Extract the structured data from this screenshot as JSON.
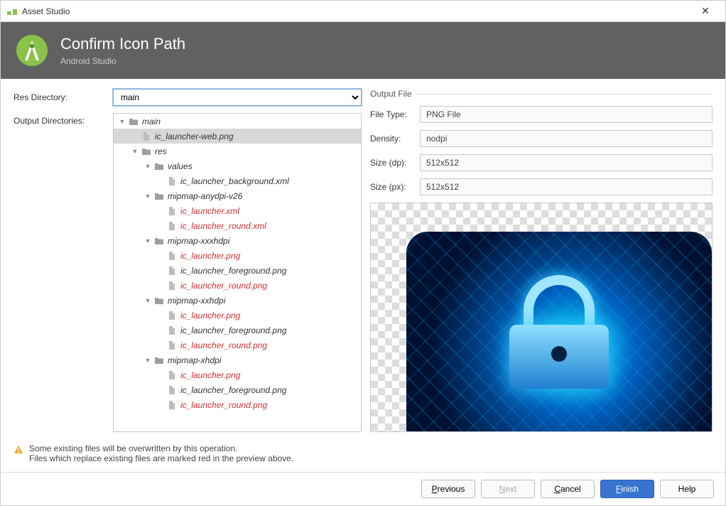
{
  "window": {
    "title": "Asset Studio"
  },
  "header": {
    "title": "Confirm Icon Path",
    "subtitle": "Android Studio"
  },
  "form": {
    "res_directory_label": "Res Directory:",
    "res_directory_value": "main",
    "output_directories_label": "Output Directories:"
  },
  "tree": [
    {
      "depth": 0,
      "type": "folder",
      "expanded": true,
      "name": "main"
    },
    {
      "depth": 1,
      "type": "file",
      "name": "ic_launcher-web.png",
      "selected": true
    },
    {
      "depth": 1,
      "type": "folder",
      "expanded": true,
      "name": "res"
    },
    {
      "depth": 2,
      "type": "folder",
      "expanded": true,
      "name": "values"
    },
    {
      "depth": 3,
      "type": "file",
      "name": "ic_launcher_background.xml"
    },
    {
      "depth": 2,
      "type": "folder",
      "expanded": true,
      "name": "mipmap-anydpi-v26"
    },
    {
      "depth": 3,
      "type": "file",
      "name": "ic_launcher.xml",
      "red": true
    },
    {
      "depth": 3,
      "type": "file",
      "name": "ic_launcher_round.xml",
      "red": true
    },
    {
      "depth": 2,
      "type": "folder",
      "expanded": true,
      "name": "mipmap-xxxhdpi"
    },
    {
      "depth": 3,
      "type": "file",
      "name": "ic_launcher.png",
      "red": true
    },
    {
      "depth": 3,
      "type": "file",
      "name": "ic_launcher_foreground.png"
    },
    {
      "depth": 3,
      "type": "file",
      "name": "ic_launcher_round.png",
      "red": true
    },
    {
      "depth": 2,
      "type": "folder",
      "expanded": true,
      "name": "mipmap-xxhdpi"
    },
    {
      "depth": 3,
      "type": "file",
      "name": "ic_launcher.png",
      "red": true
    },
    {
      "depth": 3,
      "type": "file",
      "name": "ic_launcher_foreground.png"
    },
    {
      "depth": 3,
      "type": "file",
      "name": "ic_launcher_round.png",
      "red": true
    },
    {
      "depth": 2,
      "type": "folder",
      "expanded": true,
      "name": "mipmap-xhdpi"
    },
    {
      "depth": 3,
      "type": "file",
      "name": "ic_launcher.png",
      "red": true
    },
    {
      "depth": 3,
      "type": "file",
      "name": "ic_launcher_foreground.png"
    },
    {
      "depth": 3,
      "type": "file",
      "name": "ic_launcher_round.png",
      "red": true
    }
  ],
  "output_file": {
    "section_label": "Output File",
    "file_type_label": "File Type:",
    "file_type_value": "PNG File",
    "density_label": "Density:",
    "density_value": "nodpi",
    "size_dp_label": "Size (dp):",
    "size_dp_value": "512x512",
    "size_px_label": "Size (px):",
    "size_px_value": "512x512"
  },
  "warning": {
    "line1": "Some existing files will be overwritten by this operation.",
    "line2": "Files which replace existing files are marked red in the preview above."
  },
  "buttons": {
    "previous": "Previous",
    "next": "Next",
    "cancel": "Cancel",
    "finish": "Finish",
    "help": "Help"
  }
}
